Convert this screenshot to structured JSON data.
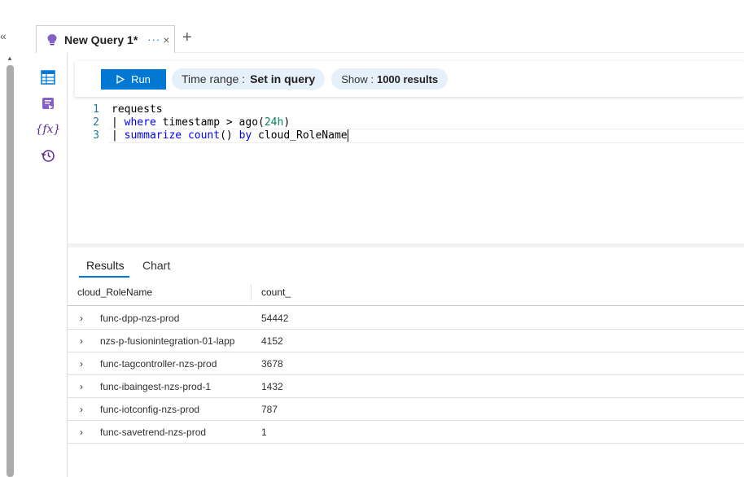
{
  "tab": {
    "title": "New Query 1*",
    "more": "···",
    "close": "×",
    "add": "+"
  },
  "nav": {
    "collapse": "«"
  },
  "toolbar": {
    "run_label": "Run",
    "time_range_label": "Time range :",
    "time_range_value": "Set in query",
    "show_label": "Show :",
    "show_value": "1000 results"
  },
  "editor": {
    "lines": [
      {
        "num": "1",
        "parts": [
          {
            "t": "requests",
            "k": "plain"
          }
        ]
      },
      {
        "num": "2",
        "parts": [
          {
            "t": "| ",
            "k": "plain"
          },
          {
            "t": "where",
            "k": "kw"
          },
          {
            "t": " timestamp > ago(",
            "k": "plain"
          },
          {
            "t": "24h",
            "k": "num"
          },
          {
            "t": ")",
            "k": "plain"
          }
        ]
      },
      {
        "num": "3",
        "parts": [
          {
            "t": "| ",
            "k": "plain"
          },
          {
            "t": "summarize",
            "k": "kw"
          },
          {
            "t": " ",
            "k": "plain"
          },
          {
            "t": "count",
            "k": "kw"
          },
          {
            "t": "() ",
            "k": "plain"
          },
          {
            "t": "by",
            "k": "kw"
          },
          {
            "t": " cloud_RoleName",
            "k": "plain"
          }
        ]
      }
    ]
  },
  "results": {
    "tabs": [
      "Results",
      "Chart"
    ],
    "columns": [
      "cloud_RoleName",
      "count_"
    ],
    "rows": [
      [
        "func-dpp-nzs-prod",
        "54442"
      ],
      [
        "nzs-p-fusionintegration-01-lapp",
        "4152"
      ],
      [
        "func-tagcontroller-nzs-prod",
        "3678"
      ],
      [
        "func-ibaingest-nzs-prod-1",
        "1432"
      ],
      [
        "func-iotconfig-nzs-prod",
        "787"
      ],
      [
        "func-savetrend-nzs-prod",
        "1"
      ]
    ]
  },
  "colors": {
    "accent": "#0078d4",
    "icon": "#5c2d91",
    "pill_bg": "#e6f0fb"
  }
}
